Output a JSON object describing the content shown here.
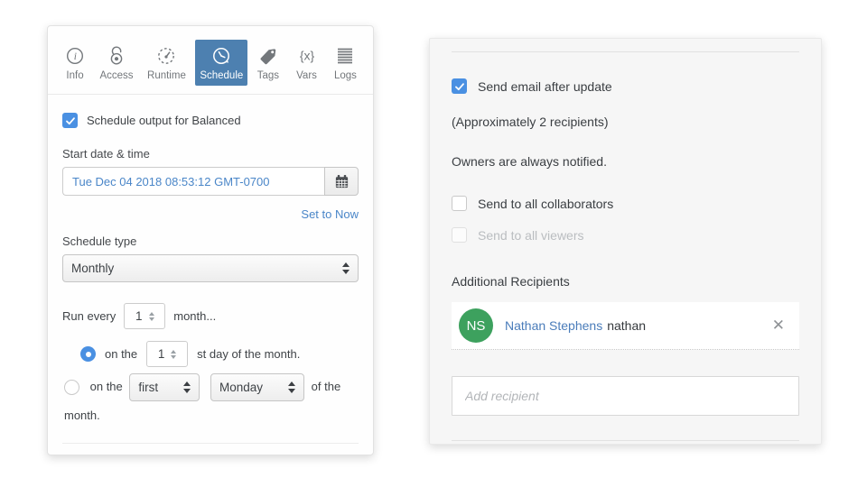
{
  "left_panel": {
    "toolbar": {
      "info_glyph": "i",
      "vars_glyph": "{x}",
      "items": [
        {
          "label": "Info",
          "icon": "info-icon",
          "active": false
        },
        {
          "label": "Access",
          "icon": "unlock-icon",
          "active": false
        },
        {
          "label": "Runtime",
          "icon": "gauge-icon",
          "active": false
        },
        {
          "label": "Schedule",
          "icon": "clock-history-icon",
          "active": true
        },
        {
          "label": "Tags",
          "icon": "tag-icon",
          "active": false
        },
        {
          "label": "Vars",
          "icon": "braces-x-icon",
          "active": false
        },
        {
          "label": "Logs",
          "icon": "log-lines-icon",
          "active": false
        }
      ]
    },
    "schedule_checkbox_label": "Schedule output for Balanced",
    "start_date_label": "Start date & time",
    "start_date_value": "Tue Dec 04 2018 08:53:12 GMT-0700",
    "set_to_now_label": "Set to Now",
    "schedule_type_label": "Schedule type",
    "schedule_type_value": "Monthly",
    "run_every": {
      "prefix": "Run every",
      "value": "1",
      "suffix": "month..."
    },
    "radio_day": {
      "prefix": "on the",
      "value": "1",
      "suffix": "st day of the month.",
      "selected": true
    },
    "radio_weekday": {
      "prefix": "on the",
      "ordinal": "first",
      "weekday": "Monday",
      "suffix": "of the month.",
      "selected": false
    }
  },
  "right_panel": {
    "send_email_label": "Send email after update",
    "recipients_note": "(Approximately 2 recipients)",
    "owners_note": "Owners are always notified.",
    "collaborators_label": "Send to all collaborators",
    "viewers_label": "Send to all viewers",
    "additional_recipients_label": "Additional Recipients",
    "recipient": {
      "initials": "NS",
      "name": "Nathan Stephens",
      "username": "nathan",
      "remove_glyph": "✕"
    },
    "add_recipient_placeholder": "Add recipient"
  },
  "colors": {
    "accent_blue": "#4a90e2",
    "active_tab_blue": "#4d80b0",
    "link_blue": "#4a86c8",
    "avatar_green": "#3da15e",
    "panel_right_bg": "#f6f6f6"
  }
}
